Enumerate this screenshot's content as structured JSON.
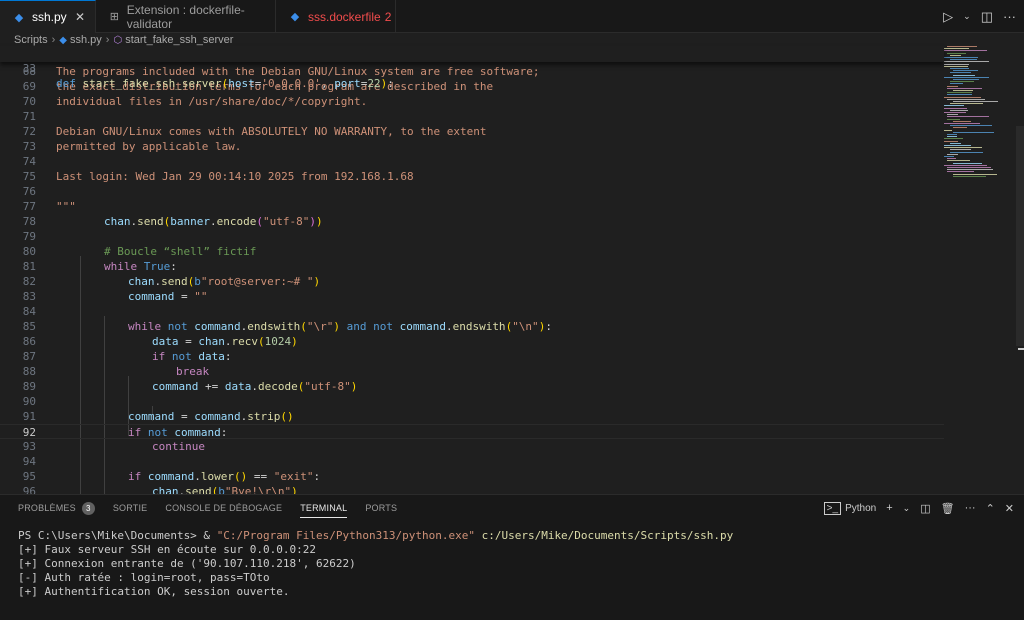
{
  "tabs": [
    {
      "label": "ssh.py",
      "close": "✕"
    },
    {
      "label": "Extension : dockerfile-validator"
    },
    {
      "label": "sss.dockerfile",
      "count": "2"
    }
  ],
  "breadcrumb": [
    "Scripts",
    "ssh.py",
    "start_fake_ssh_server"
  ],
  "sticky": {
    "number": "33",
    "code": "def start_fake_ssh_server(host='0.0.0.0', port=22):"
  },
  "numbers": [
    "68",
    "69",
    "70",
    "71",
    "72",
    "73",
    "74",
    "75",
    "76",
    "77",
    "78",
    "79",
    "80",
    "81",
    "82",
    "83",
    "84",
    "85",
    "86",
    "87",
    "88",
    "89",
    "90",
    "91",
    "92",
    "93",
    "94",
    "95",
    "96"
  ],
  "code": {
    "l68": "The programs included with the Debian GNU/Linux system are free software;",
    "l69": "the exact distribution terms for each program are described in the",
    "l70": "individual files in /usr/share/doc/*/copyright.",
    "l72": "Debian GNU/Linux comes with ABSOLUTELY NO WARRANTY, to the extent",
    "l73": "permitted by applicable law.",
    "l75": "Last login: Wed Jan 29 00:14:10 2025 from 192.168.1.68",
    "l77": "\"\"\"",
    "l80": "# Boucle “shell” fictif"
  },
  "panel": {
    "tabs": [
      "PROBLÈMES",
      "SORTIE",
      "CONSOLE DE DÉBOGAGE",
      "TERMINAL",
      "PORTS"
    ],
    "problems_count": "3",
    "shell": "Python"
  },
  "terminal": {
    "prompt": "PS C:\\Users\\Mike\\Documents> & ",
    "exe": "\"C:/Program Files/Python313/python.exe\"",
    "script": " c:/Users/Mike/Documents/Scripts/ssh.py",
    "lines": [
      "[+] Faux serveur SSH en écoute sur 0.0.0.0:22",
      "[+] Connexion entrante de ('90.107.110.218', 62622)",
      "[-] Auth ratée : login=root, pass=TOto",
      "[+] Authentification OK, session ouverte."
    ]
  },
  "colors": {
    "accent": "#0078d4",
    "error": "#f14c4c",
    "string": "#ce9178",
    "keyword": "#569cd6"
  }
}
